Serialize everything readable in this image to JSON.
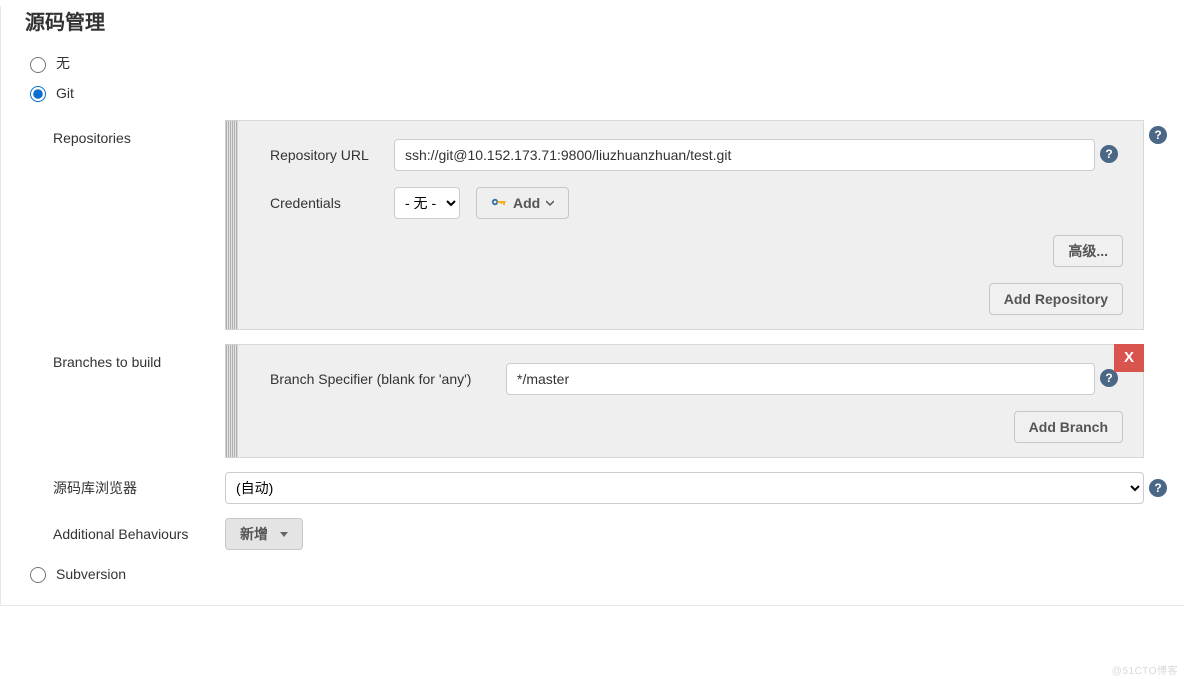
{
  "section_title": "源码管理",
  "scm": {
    "options": [
      "无",
      "Git",
      "Subversion"
    ],
    "selected": "Git"
  },
  "repositories": {
    "label": "Repositories",
    "url_label": "Repository URL",
    "url_value": "ssh://git@10.152.173.71:9800/liuzhuanzhuan/test.git",
    "cred_label": "Credentials",
    "cred_value": "- 无 -",
    "add_button": "Add",
    "advanced_button": "高级...",
    "add_repo_button": "Add Repository"
  },
  "branches": {
    "label": "Branches to build",
    "spec_label": "Branch Specifier (blank for 'any')",
    "spec_value": "*/master",
    "delete_label": "X",
    "add_branch_button": "Add Branch"
  },
  "browser": {
    "label": "源码库浏览器",
    "value": "(自动)"
  },
  "behaviours": {
    "label": "Additional Behaviours",
    "add_button": "新增"
  },
  "watermark": "@51CTO博客"
}
